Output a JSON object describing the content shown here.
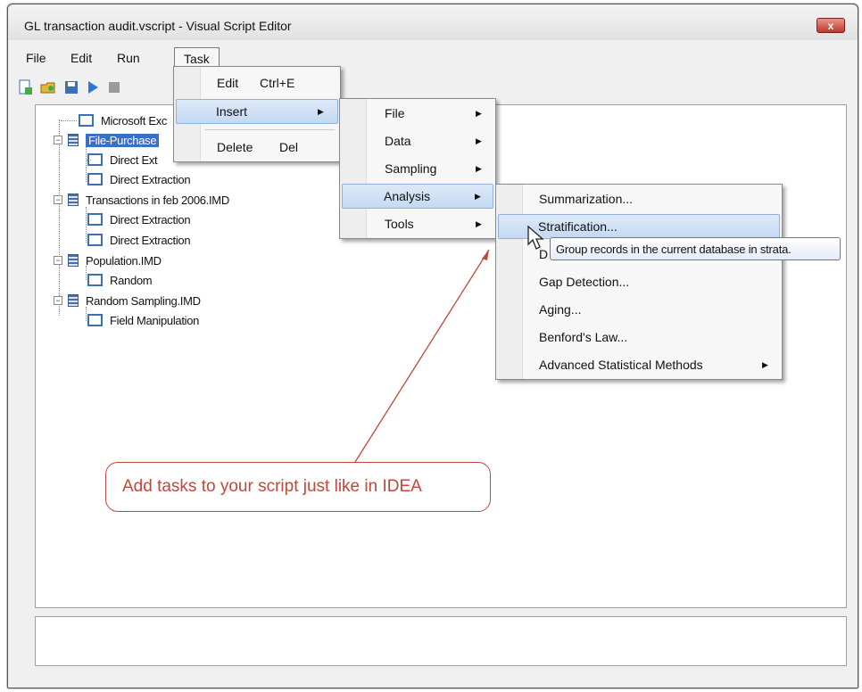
{
  "window": {
    "title": "GL transaction audit.vscript - Visual Script Editor",
    "close_label": "x"
  },
  "menubar": {
    "items": [
      "File",
      "Edit",
      "Run",
      "Task"
    ]
  },
  "task_menu": {
    "items": [
      {
        "label": "Edit",
        "shortcut": "Ctrl+E"
      },
      {
        "label": "Insert",
        "shortcut": ""
      },
      {
        "label": "Delete",
        "shortcut": "Del"
      }
    ]
  },
  "insert_menu": {
    "items": [
      "File",
      "Data",
      "Sampling",
      "Analysis",
      "Tools"
    ]
  },
  "analysis_menu": {
    "items": [
      "Summarization...",
      "Stratification...",
      "D",
      "Gap Detection...",
      "Aging...",
      "Benford's Law...",
      "Advanced Statistical Methods"
    ]
  },
  "tooltip": {
    "text": "Group records in the current database in strata."
  },
  "tree": {
    "nodes": [
      "Microsoft Exc",
      "File-Purchase",
      "Direct Ext",
      "Direct Extraction",
      "Transactions in feb 2006.IMD",
      "Direct Extraction",
      "Direct Extraction",
      "Population.IMD",
      "Random",
      "Random Sampling.IMD",
      "Field Manipulation"
    ]
  },
  "callout": {
    "text": "Add tasks to your script just like in IDEA",
    "color": "#c0473b"
  },
  "colors": {
    "highlight": "#c4d9f3",
    "node_border": "#3b6fb6"
  }
}
